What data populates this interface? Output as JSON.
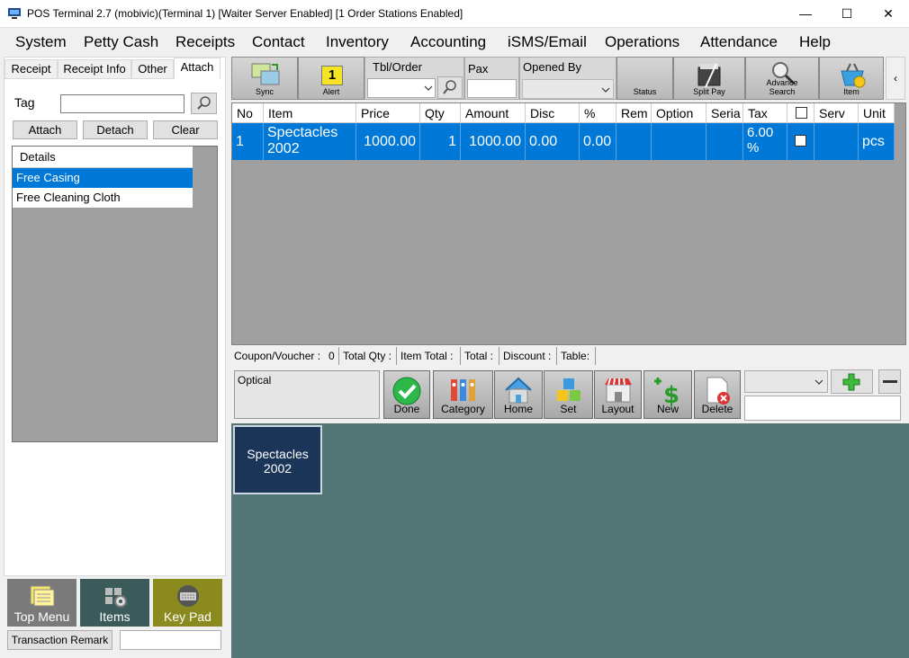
{
  "window": {
    "title": "POS Terminal 2.7 (mobivic)(Terminal 1) [Waiter Server Enabled] [1 Order Stations Enabled]",
    "minimize": "—",
    "maximize": "☐",
    "close": "✕"
  },
  "menu": [
    "System",
    "Petty Cash",
    "Receipts",
    "Contact",
    "Inventory",
    "Accounting",
    "iSMS/Email",
    "Operations",
    "Attendance",
    "Help"
  ],
  "left_tabs": [
    "Receipt",
    "Receipt Info",
    "Other",
    "Attach"
  ],
  "attach": {
    "tag_label": "Tag",
    "tag_value": "",
    "attach_button": "Attach",
    "detach_button": "Detach",
    "clear_button": "Clear",
    "list_header": "Details",
    "items": [
      "Free Casing",
      "Free Cleaning Cloth"
    ],
    "selected_index": 0
  },
  "nav_buttons": {
    "top_menu": "Top Menu",
    "items": "Items",
    "key_pad": "Key Pad"
  },
  "transaction_remark_button": "Transaction Remark",
  "transaction_remark_value": "",
  "toolbar": {
    "sync": "Sync",
    "alert": "Alert",
    "alert_count": "1",
    "tbl_order_label": "Tbl/Order",
    "pax_label": "Pax",
    "opened_by_label": "Opened By",
    "status": "Status",
    "split_pay": "Split Pay",
    "advance_search_1": "Advance",
    "advance_search_2": "Search",
    "item": "Item",
    "scroll_left": "‹"
  },
  "grid": {
    "columns": [
      "No",
      "Item",
      "Price",
      "Qty",
      "Amount",
      "Disc",
      "%",
      "Rem",
      "Option",
      "Seria",
      "Tax",
      "",
      "Serv",
      "Unit"
    ],
    "rows": [
      {
        "no": "1",
        "item_1": "Spectacles",
        "item_2": "2002",
        "price": "1000.00",
        "qty": "1",
        "amount": "1000.00",
        "disc": "0.00",
        "pct": "0.00",
        "rem": "",
        "option": "",
        "serial": "",
        "tax_1": "6.00",
        "tax_2": "%",
        "serv": "",
        "unit": "pcs"
      }
    ]
  },
  "summary": {
    "coupon_label": "Coupon/Voucher :",
    "coupon_value": "0",
    "total_qty": "Total Qty :",
    "item_total": "Item Total :",
    "total": "Total :",
    "discount": "Discount :",
    "table": "Table:"
  },
  "category_box": "Optical",
  "actions": [
    "Done",
    "Category",
    "Home",
    "Set",
    "Layout",
    "New",
    "Delete"
  ],
  "product_tiles": [
    {
      "line1": "Spectacles",
      "line2": "2002"
    }
  ],
  "colors": {
    "selection": "#0078d7",
    "product_area": "#527575",
    "tile": "#1a3557",
    "items_nav": "#3b5b5b",
    "keypad_nav": "#8a8a1f",
    "topmenu_nav": "#7a7a7a"
  }
}
